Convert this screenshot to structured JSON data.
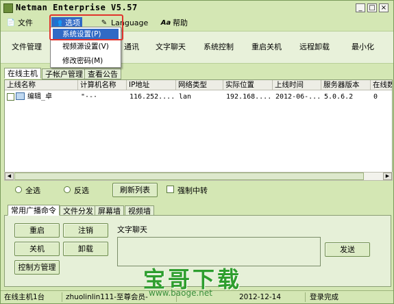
{
  "window": {
    "title": "Netman Enterprise V5.57",
    "controls": [
      "_",
      "□",
      "×"
    ]
  },
  "menu": [
    {
      "label": "文件",
      "icon": "document-icon"
    },
    {
      "label": "选项",
      "icon": "options-icon"
    },
    {
      "label": "Language",
      "icon": "language-icon"
    },
    {
      "label": "帮助",
      "icon": "help-icon"
    }
  ],
  "dropdown": [
    {
      "label": "系统设置(P)"
    },
    {
      "label": "视频源设置(V)"
    },
    {
      "label": "修改密码(M)"
    }
  ],
  "toolbar": [
    "文件管理",
    "通讯",
    "文字聊天",
    "系统控制",
    "重启关机",
    "远程卸载",
    "最小化"
  ],
  "top_tabs": [
    "在线主机",
    "子帐户管理",
    "查看公告"
  ],
  "table": {
    "headers": [
      "上线名称",
      "计算机名称",
      "IP地址",
      "网络类型",
      "实际位置",
      "上线时间",
      "服务器版本",
      "在线数"
    ],
    "rows": [
      [
        "编辑_卓",
        "\"·-·",
        "116.252....",
        "lan",
        "192.168....",
        "2012-06-...",
        "5.0.6.2",
        "0"
      ]
    ]
  },
  "controls": {
    "select_all": "全选",
    "invert": "反选",
    "refresh": "刷新列表",
    "force_relay": "强制中转"
  },
  "bottom_tabs": [
    "常用广播命令",
    "文件分发",
    "屏幕墙",
    "视频墙"
  ],
  "commands": {
    "restart": "重启",
    "logout": "注销",
    "shutdown": "关机",
    "uninstall": "卸载",
    "controller": "控制方管理",
    "chat_label": "文字聊天",
    "send": "发送"
  },
  "watermark": {
    "title": "宝哥下载",
    "url": "www.baoge.net"
  },
  "status": {
    "online": "在线主机1台",
    "account": "zhuolinlin111-至尊会员-",
    "date": "2012-12-14",
    "login": "登录完成"
  }
}
